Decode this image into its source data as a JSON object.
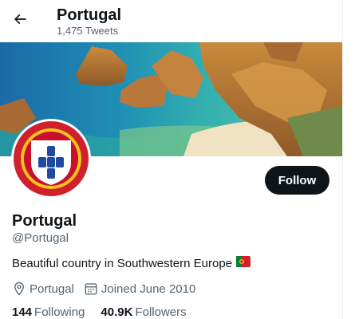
{
  "header": {
    "title": "Portugal",
    "tweet_count": "1,475 Tweets"
  },
  "profile": {
    "name": "Portugal",
    "handle": "@Portugal",
    "bio": "Beautiful country in Southwestern Europe",
    "bio_emoji": "portugal-flag-icon",
    "location": "Portugal",
    "joined": "Joined June 2010",
    "follow_label": "Follow"
  },
  "stats": {
    "following_count": "144",
    "following_label": "Following",
    "followers_count": "40.9K",
    "followers_label": "Followers"
  },
  "colors": {
    "primary_text": "#0f1419",
    "secondary_text": "#536471",
    "follow_bg": "#0f1419"
  }
}
